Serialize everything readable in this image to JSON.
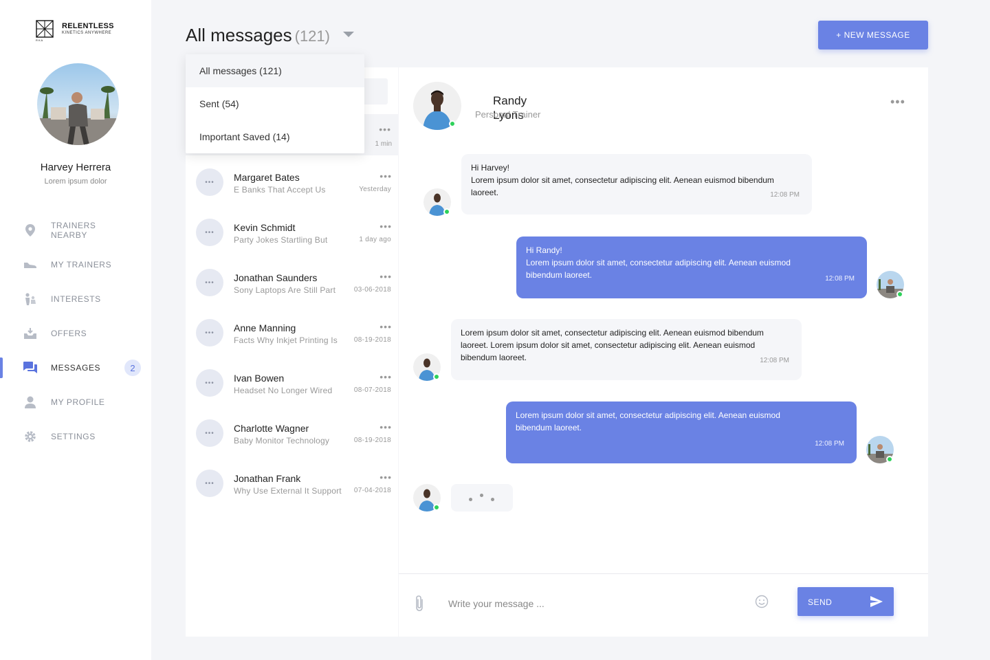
{
  "brand": {
    "title": "RELENTLESS",
    "subtitle": "KINETICS ANYWHERE",
    "mark_letters": "R K A"
  },
  "user": {
    "name": "Harvey Herrera",
    "tagline": "Lorem ipsum dolor"
  },
  "nav": [
    {
      "label": "TRAINERS NEARBY",
      "icon": "location-pin-icon"
    },
    {
      "label": "MY TRAINERS",
      "icon": "sneaker-icon"
    },
    {
      "label": "INTERESTS",
      "icon": "people-icon"
    },
    {
      "label": "OFFERS",
      "icon": "inbox-tray-icon"
    },
    {
      "label": "MESSAGES",
      "icon": "chat-icon",
      "badge": "2",
      "active": true
    },
    {
      "label": "MY PROFILE",
      "icon": "person-icon"
    },
    {
      "label": "SETTINGS",
      "icon": "gear-icon"
    }
  ],
  "header": {
    "title": "All messages",
    "count": "(121)",
    "new_message_label": "+ NEW MESSAGE"
  },
  "filter_dropdown": {
    "options": [
      "All messages (121)",
      "Sent (54)",
      "Important Saved (14)"
    ],
    "selected": "All messages (121)"
  },
  "first_conversation": {
    "time": "1 min"
  },
  "conversations": [
    {
      "name": "Margaret Bates",
      "preview": "E Banks That Accept Us",
      "time": "Yesterday"
    },
    {
      "name": "Kevin Schmidt",
      "preview": "Party Jokes Startling But",
      "time": "1 day ago"
    },
    {
      "name": "Jonathan Saunders",
      "preview": "Sony Laptops Are Still Part",
      "time": "03-06-2018"
    },
    {
      "name": "Anne Manning",
      "preview": "Facts Why Inkjet Printing Is",
      "time": "08-19-2018"
    },
    {
      "name": "Ivan Bowen",
      "preview": "Headset No Longer Wired",
      "time": "08-07-2018"
    },
    {
      "name": "Charlotte Wagner",
      "preview": "Baby Monitor Technology",
      "time": "08-19-2018"
    },
    {
      "name": "Jonathan Frank",
      "preview": "Why Use External It Support",
      "time": "07-04-2018"
    }
  ],
  "chat": {
    "contact_name": "Randy Lyons",
    "contact_role": "Personal Trainer",
    "messages": [
      {
        "direction": "in",
        "lines": [
          "Hi  Harvey!",
          "Lorem ipsum dolor sit amet, consectetur adipiscing elit. Aenean euismod bibendum laoreet."
        ],
        "time": "12:08 PM"
      },
      {
        "direction": "out",
        "lines": [
          "Hi  Randy!",
          "Lorem ipsum dolor sit amet, consectetur adipiscing elit. Aenean euismod bibendum laoreet."
        ],
        "time": "12:08 PM"
      },
      {
        "direction": "in",
        "lines": [
          "Lorem ipsum dolor sit amet, consectetur adipiscing elit. Aenean euismod bibendum laoreet. Lorem ipsum dolor sit amet, consectetur adipiscing elit. Aenean euismod bibendum laoreet."
        ],
        "time": "12:08 PM"
      },
      {
        "direction": "out",
        "lines": [
          "Lorem ipsum dolor sit amet, consectetur adipiscing elit. Aenean euismod bibendum laoreet."
        ],
        "time": "12:08 PM"
      }
    ],
    "typing": true
  },
  "composer": {
    "placeholder": "Write your message ...",
    "value": "",
    "send_label": "SEND"
  },
  "colors": {
    "accent": "#6a82e4",
    "online": "#2ed15a",
    "background": "#f4f5f8"
  }
}
